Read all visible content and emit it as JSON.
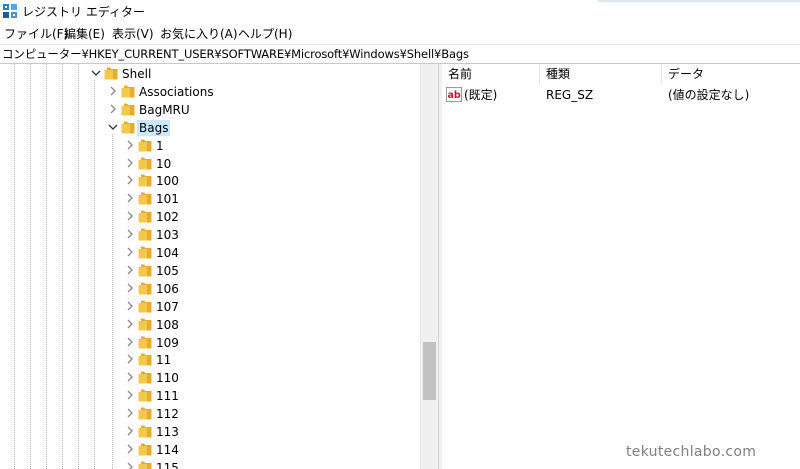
{
  "window": {
    "title": "レジストリ エディター",
    "app_icon": "registry-editor-icon"
  },
  "menu": [
    "ファイル(F)",
    "編集(E)",
    "表示(V)",
    "お気に入り(A)",
    "ヘルプ(H)"
  ],
  "address_bar": {
    "path": "コンピューター¥HKEY_CURRENT_USER¥SOFTWARE¥Microsoft¥Windows¥Shell¥Bags"
  },
  "tree": {
    "nodes": [
      {
        "label": "Shell",
        "expanded": true,
        "selected": false
      },
      {
        "label": "Associations",
        "expanded": false,
        "selected": false
      },
      {
        "label": "BagMRU",
        "expanded": false,
        "selected": false
      },
      {
        "label": "Bags",
        "expanded": true,
        "selected": true
      },
      {
        "label": "1",
        "expanded": false,
        "selected": false
      },
      {
        "label": "10",
        "expanded": false,
        "selected": false
      },
      {
        "label": "100",
        "expanded": false,
        "selected": false
      },
      {
        "label": "101",
        "expanded": false,
        "selected": false
      },
      {
        "label": "102",
        "expanded": false,
        "selected": false
      },
      {
        "label": "103",
        "expanded": false,
        "selected": false
      },
      {
        "label": "104",
        "expanded": false,
        "selected": false
      },
      {
        "label": "105",
        "expanded": false,
        "selected": false
      },
      {
        "label": "106",
        "expanded": false,
        "selected": false
      },
      {
        "label": "107",
        "expanded": false,
        "selected": false
      },
      {
        "label": "108",
        "expanded": false,
        "selected": false
      },
      {
        "label": "109",
        "expanded": false,
        "selected": false
      },
      {
        "label": "11",
        "expanded": false,
        "selected": false
      },
      {
        "label": "110",
        "expanded": false,
        "selected": false
      },
      {
        "label": "111",
        "expanded": false,
        "selected": false
      },
      {
        "label": "112",
        "expanded": false,
        "selected": false
      },
      {
        "label": "113",
        "expanded": false,
        "selected": false
      },
      {
        "label": "114",
        "expanded": false,
        "selected": false
      },
      {
        "label": "115",
        "expanded": false,
        "selected": false
      }
    ]
  },
  "values_pane": {
    "columns": [
      "名前",
      "種類",
      "データ"
    ],
    "rows": [
      {
        "icon": "string-value-icon",
        "name": "(既定)",
        "type": "REG_SZ",
        "data": "(値の設定なし)"
      }
    ]
  },
  "watermark": "tekutechlabo.com",
  "colors": {
    "selection": "#cce8ff",
    "folder": "#f4c84a",
    "scrollbar_thumb": "#c2c2c2",
    "string_icon_red": "#c8102e"
  }
}
